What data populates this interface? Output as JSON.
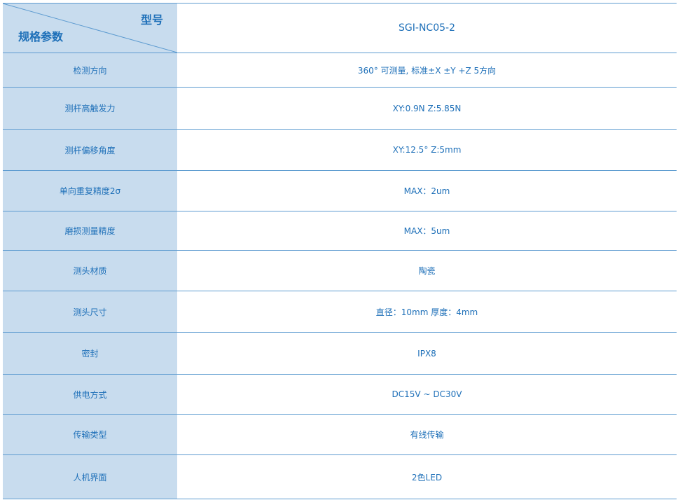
{
  "header": {
    "model_label": "型号",
    "params_label": "规格参数",
    "model_value": "SGI-NC05-2"
  },
  "rows": [
    {
      "label": "检测方向",
      "value": "360° 可测量, 标准±X ±Y +Z 5方向"
    },
    {
      "label": "测杆高触发力",
      "value": "XY:0.9N   Z:5.85N"
    },
    {
      "label": "测杆偏移角度",
      "value": "XY:12.5° Z:5mm"
    },
    {
      "label": "单向重复精度2σ",
      "value": "MAX：2um"
    },
    {
      "label": "磨损测量精度",
      "value": "MAX：5um"
    },
    {
      "label": "测头材质",
      "value": "陶瓷"
    },
    {
      "label": "测头尺寸",
      "value": "直径：10mm  厚度：4mm"
    },
    {
      "label": "密封",
      "value": "IPX8"
    },
    {
      "label": "供电方式",
      "value": "DC15V ~ DC30V"
    },
    {
      "label": "传输类型",
      "value": "有线传输"
    },
    {
      "label": "人机界面",
      "value": "2色LED"
    }
  ]
}
